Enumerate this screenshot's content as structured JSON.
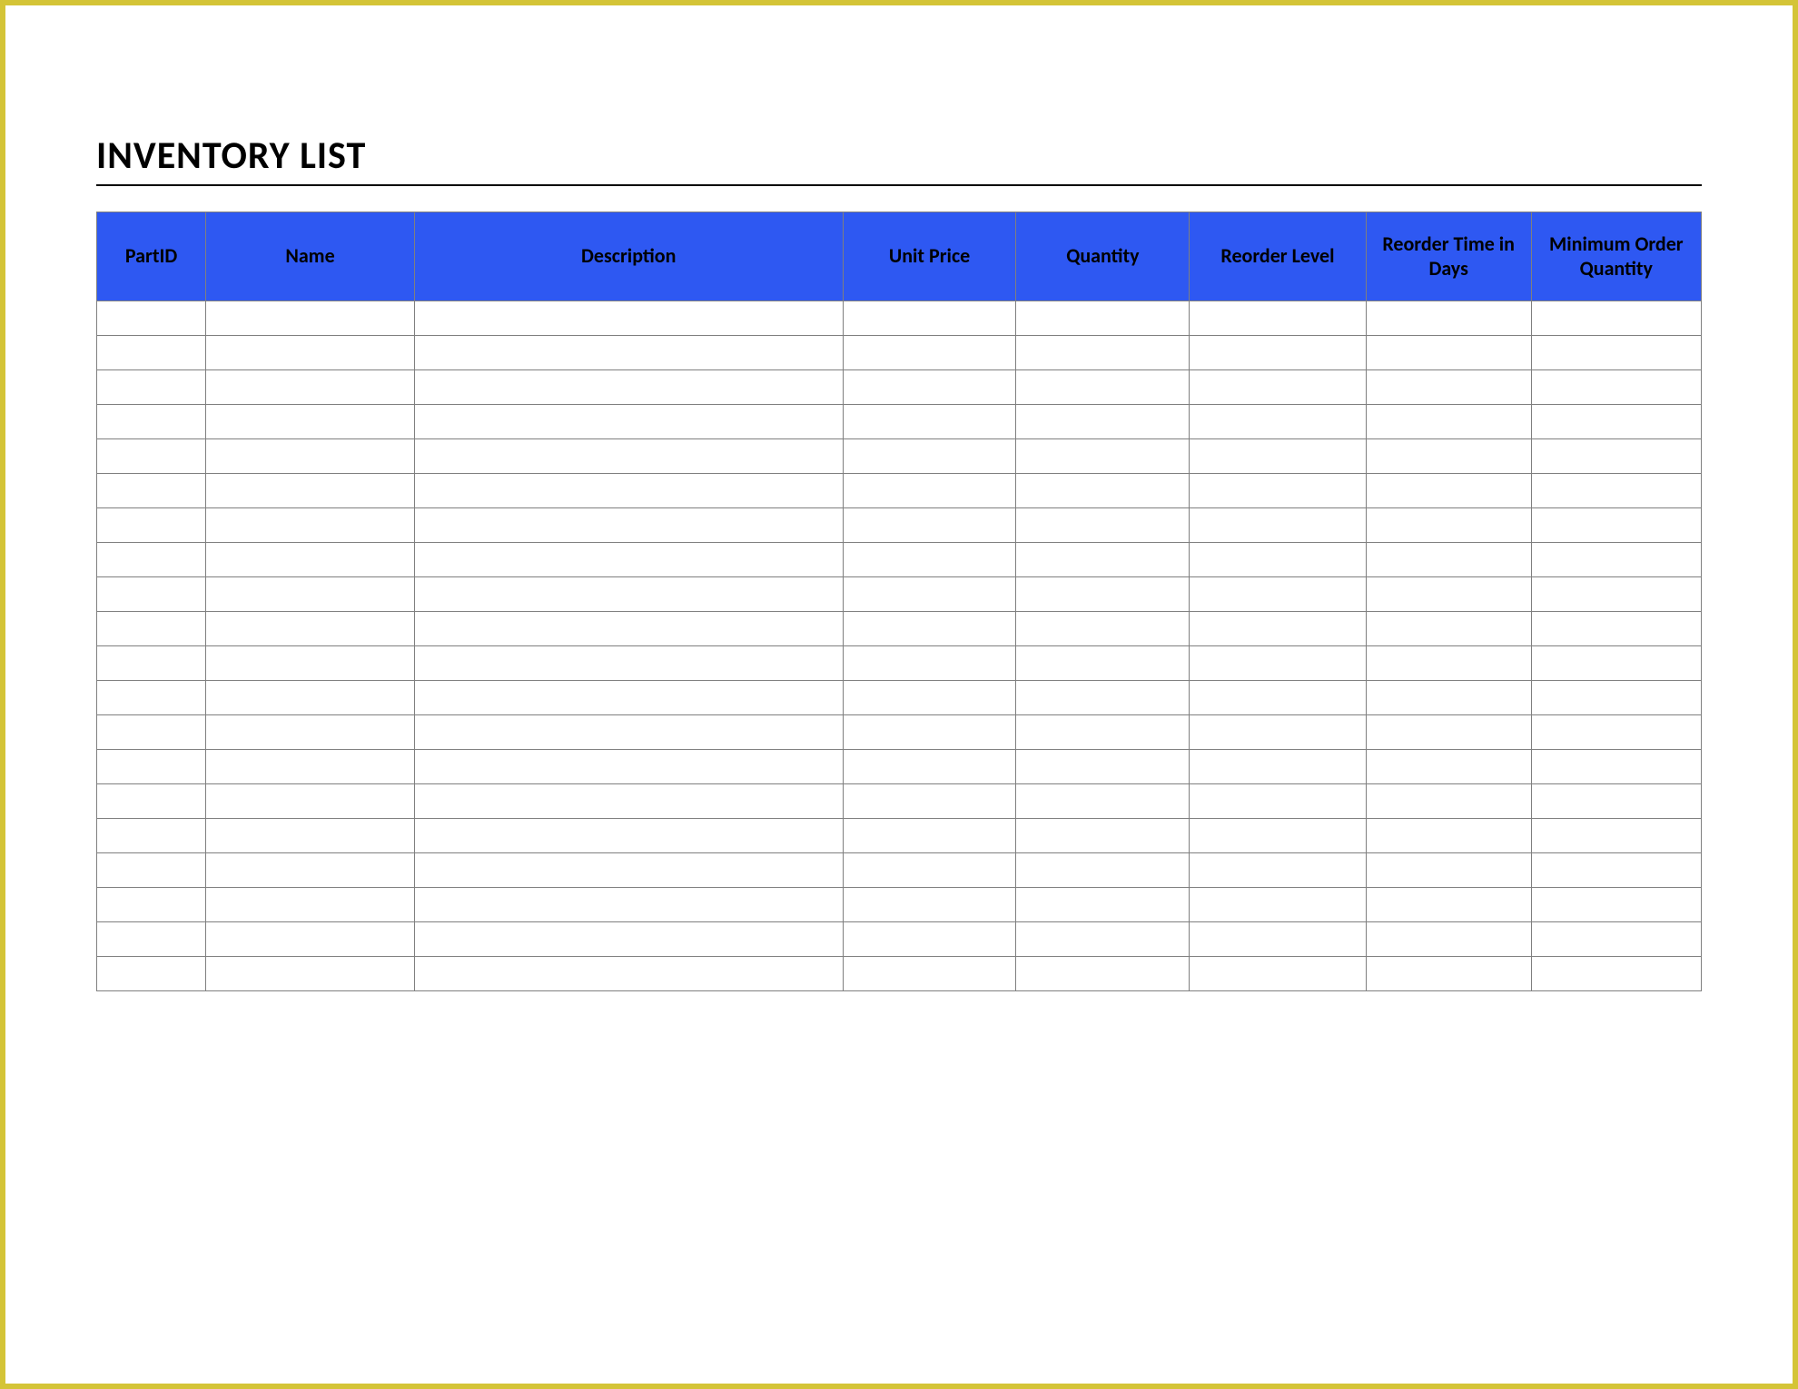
{
  "title": "INVENTORY LIST",
  "header_bg": "#2e58f2",
  "columns": [
    {
      "key": "partid",
      "label": "PartID"
    },
    {
      "key": "name",
      "label": "Name"
    },
    {
      "key": "desc",
      "label": "Description"
    },
    {
      "key": "price",
      "label": "Unit Price"
    },
    {
      "key": "qty",
      "label": "Quantity"
    },
    {
      "key": "reorder",
      "label": "Reorder Level"
    },
    {
      "key": "days",
      "label": "Reorder Time in Days"
    },
    {
      "key": "minqty",
      "label": "Minimum Order Quantity"
    }
  ],
  "rows": [
    {
      "partid": "",
      "name": "",
      "desc": "",
      "price": "",
      "qty": "",
      "reorder": "",
      "days": "",
      "minqty": ""
    },
    {
      "partid": "",
      "name": "",
      "desc": "",
      "price": "",
      "qty": "",
      "reorder": "",
      "days": "",
      "minqty": ""
    },
    {
      "partid": "",
      "name": "",
      "desc": "",
      "price": "",
      "qty": "",
      "reorder": "",
      "days": "",
      "minqty": ""
    },
    {
      "partid": "",
      "name": "",
      "desc": "",
      "price": "",
      "qty": "",
      "reorder": "",
      "days": "",
      "minqty": ""
    },
    {
      "partid": "",
      "name": "",
      "desc": "",
      "price": "",
      "qty": "",
      "reorder": "",
      "days": "",
      "minqty": ""
    },
    {
      "partid": "",
      "name": "",
      "desc": "",
      "price": "",
      "qty": "",
      "reorder": "",
      "days": "",
      "minqty": ""
    },
    {
      "partid": "",
      "name": "",
      "desc": "",
      "price": "",
      "qty": "",
      "reorder": "",
      "days": "",
      "minqty": ""
    },
    {
      "partid": "",
      "name": "",
      "desc": "",
      "price": "",
      "qty": "",
      "reorder": "",
      "days": "",
      "minqty": ""
    },
    {
      "partid": "",
      "name": "",
      "desc": "",
      "price": "",
      "qty": "",
      "reorder": "",
      "days": "",
      "minqty": ""
    },
    {
      "partid": "",
      "name": "",
      "desc": "",
      "price": "",
      "qty": "",
      "reorder": "",
      "days": "",
      "minqty": ""
    },
    {
      "partid": "",
      "name": "",
      "desc": "",
      "price": "",
      "qty": "",
      "reorder": "",
      "days": "",
      "minqty": ""
    },
    {
      "partid": "",
      "name": "",
      "desc": "",
      "price": "",
      "qty": "",
      "reorder": "",
      "days": "",
      "minqty": ""
    },
    {
      "partid": "",
      "name": "",
      "desc": "",
      "price": "",
      "qty": "",
      "reorder": "",
      "days": "",
      "minqty": ""
    },
    {
      "partid": "",
      "name": "",
      "desc": "",
      "price": "",
      "qty": "",
      "reorder": "",
      "days": "",
      "minqty": ""
    },
    {
      "partid": "",
      "name": "",
      "desc": "",
      "price": "",
      "qty": "",
      "reorder": "",
      "days": "",
      "minqty": ""
    },
    {
      "partid": "",
      "name": "",
      "desc": "",
      "price": "",
      "qty": "",
      "reorder": "",
      "days": "",
      "minqty": ""
    },
    {
      "partid": "",
      "name": "",
      "desc": "",
      "price": "",
      "qty": "",
      "reorder": "",
      "days": "",
      "minqty": ""
    },
    {
      "partid": "",
      "name": "",
      "desc": "",
      "price": "",
      "qty": "",
      "reorder": "",
      "days": "",
      "minqty": ""
    },
    {
      "partid": "",
      "name": "",
      "desc": "",
      "price": "",
      "qty": "",
      "reorder": "",
      "days": "",
      "minqty": ""
    },
    {
      "partid": "",
      "name": "",
      "desc": "",
      "price": "",
      "qty": "",
      "reorder": "",
      "days": "",
      "minqty": ""
    }
  ]
}
